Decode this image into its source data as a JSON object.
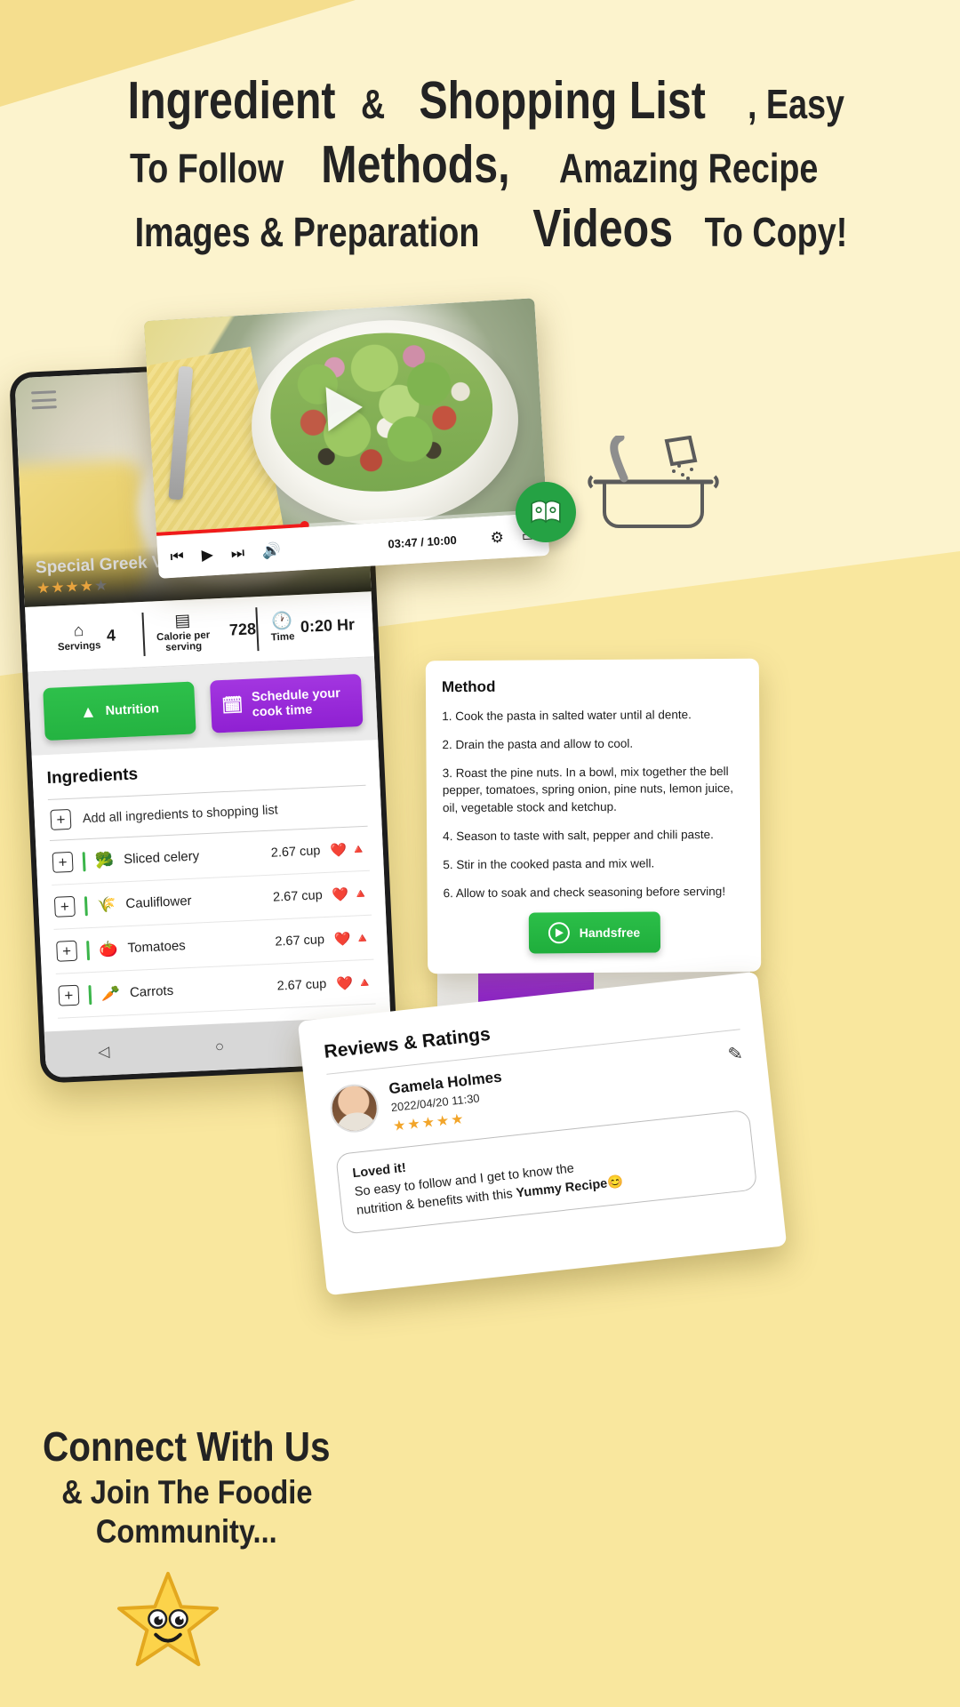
{
  "headline": {
    "line1_a": "Ingredient",
    "line1_b": "& ",
    "line1_c": "Shopping List",
    "line1_d": ", Easy",
    "line2_a": "To Follow ",
    "line2_b": "Methods,",
    "line2_c": " Amazing Recipe",
    "line3_a": "Images & Preparation ",
    "line3_b": "Videos",
    "line3_c": " To Copy!"
  },
  "phone": {
    "menu_icon": "hamburger-menu-icon",
    "recipe_title": "Special Greek Ve",
    "stars_filled": 4,
    "stars_total": 5,
    "stats": [
      {
        "icon": "cloche-icon",
        "label": "Servings",
        "value": "4"
      },
      {
        "icon": "calculator-icon",
        "label": "Calorie per serving",
        "value": "728"
      },
      {
        "icon": "clock-icon",
        "label": "Time",
        "value": "0:20 Hr"
      }
    ],
    "actions": {
      "nutrition_label": "Nutrition",
      "nutrition_icon": "food-pyramid-icon",
      "nutrition_color": "#2ec04b",
      "schedule_label": "Schedule your cook time",
      "schedule_icon": "calendar-clock-icon",
      "schedule_color": "#a336e0"
    },
    "ingredients": {
      "heading": "Ingredients",
      "add_all_label": "Add all ingredients to shopping list",
      "add_icon": "plus-box-icon",
      "items": [
        {
          "emoji": "🥦",
          "name": "Sliced celery",
          "qty": "2.67 cup",
          "heart": "❤️",
          "pyramid": "🔺"
        },
        {
          "emoji": "🌾",
          "name": "Cauliflower",
          "qty": "2.67 cup",
          "heart": "❤️",
          "pyramid": "🔺"
        },
        {
          "emoji": "🍅",
          "name": "Tomatoes",
          "qty": "2.67 cup",
          "heart": "❤️",
          "pyramid": "🔺"
        },
        {
          "emoji": "🥕",
          "name": "Carrots",
          "qty": "2.67 cup",
          "heart": "❤️",
          "pyramid": "🔺"
        }
      ]
    },
    "nav": {
      "back": "◁",
      "home": "○",
      "recents": "□"
    }
  },
  "video": {
    "play_icon": "play-triangle-icon",
    "prev_label": "⏮",
    "play_label": "▶",
    "next_label": "⏭",
    "volume_label": "🔊",
    "time": "03:47 / 10:00",
    "settings_label": "⚙",
    "fullscreen_label": "▭",
    "progress_percent": 38
  },
  "book_badge": {
    "icon": "open-book-icon",
    "color": "#25a244"
  },
  "method": {
    "title": "Method",
    "steps": [
      "1. Cook the pasta in salted water until al dente.",
      "2. Drain the pasta and allow to cool.",
      "3. Roast the pine nuts. In a bowl, mix together the bell pepper, tomatoes, spring onion, pine nuts, lemon juice, oil, vegetable stock and ketchup.",
      "4. Season to taste with salt, pepper and chili paste.",
      "5. Stir in the cooked pasta and mix well.",
      "6. Allow to soak and check seasoning before serving!"
    ],
    "handsfree_label": "Handsfree",
    "handsfree_icon": "play-circle-icon",
    "handsfree_color": "#2cbf49"
  },
  "reviews": {
    "title": "Reviews & Ratings",
    "reviewer_name": "Gamela Holmes",
    "date": "2022/04/20 11:30",
    "stars": 5,
    "edit_icon": "pencil-icon",
    "avatar_icon": "user-avatar",
    "comment_line1": "Loved it!",
    "comment_line2": "So easy to follow and I get to know the",
    "comment_line3_a": "nutrition & benefits with this ",
    "comment_line3_b": "Yummy Recipe",
    "comment_emoji": "😊"
  },
  "connect": {
    "line1": "Connect With Us",
    "line2": "& Join The Foodie",
    "line3": "Community...",
    "mascot_icon": "smiling-star-icon"
  },
  "colors": {
    "background": "#f9e79e",
    "background_light": "#fcf3cd",
    "text": "#232323",
    "green": "#2ec04b",
    "purple": "#a336e0",
    "star": "#f2a52a",
    "progress_red": "#f01a1a"
  }
}
